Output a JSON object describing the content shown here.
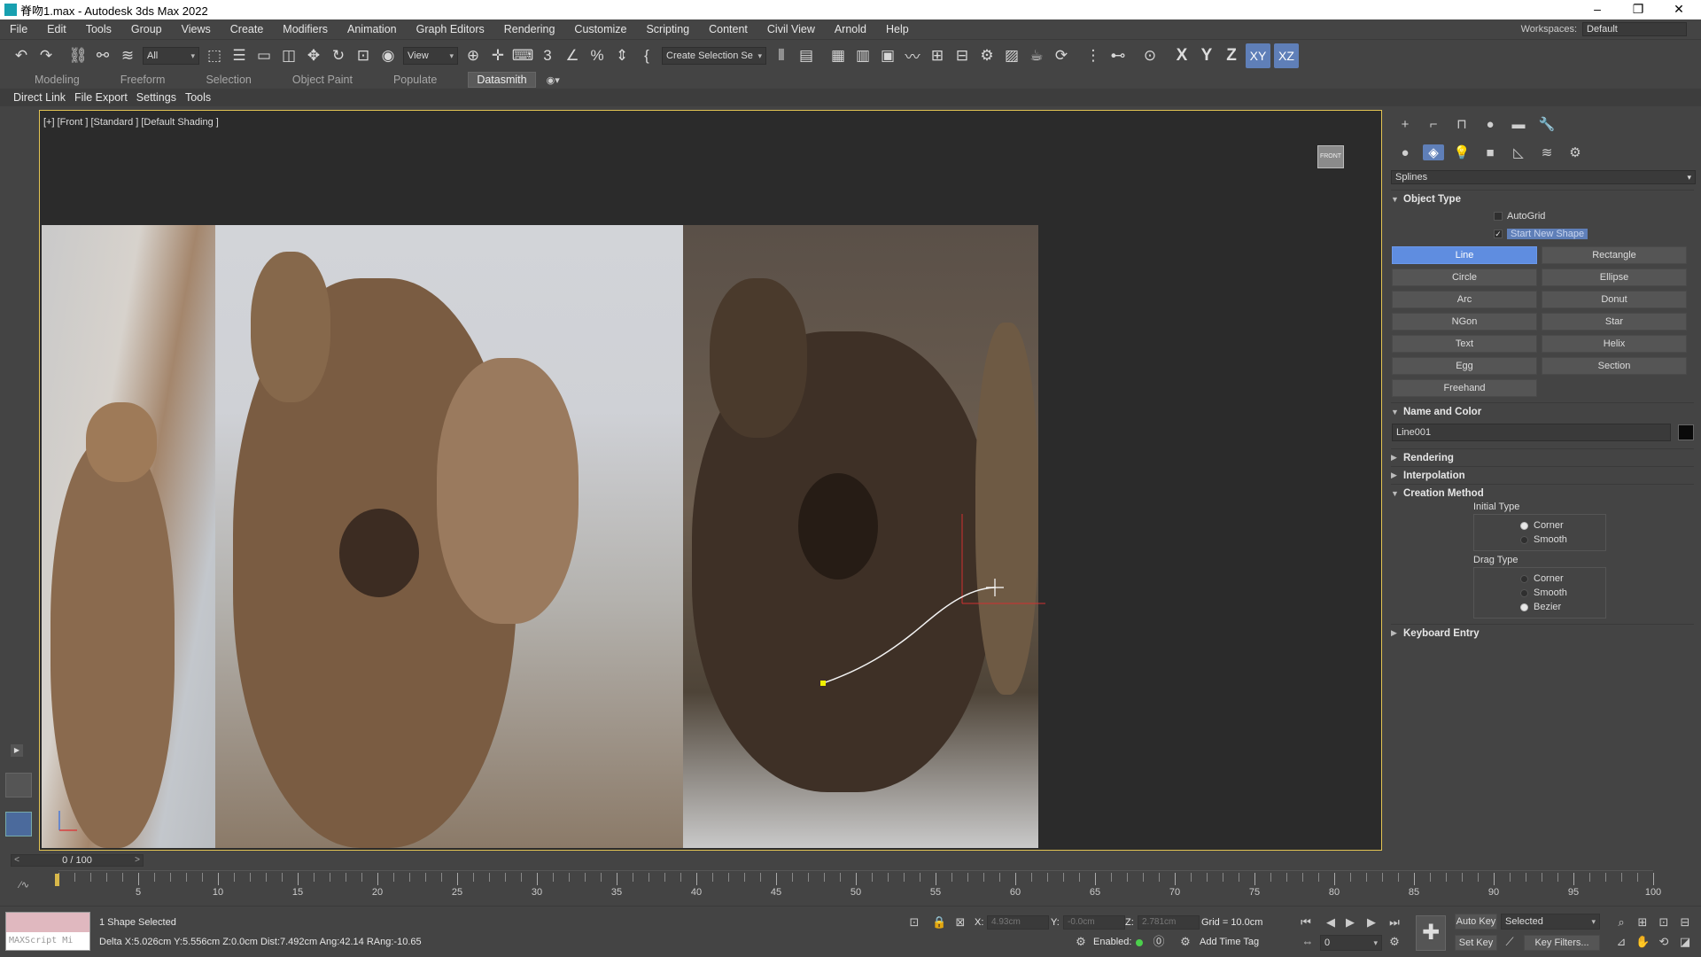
{
  "title": "脊吻1.max - Autodesk 3ds Max 2022",
  "window_controls": {
    "minimize": "–",
    "maximize": "❐",
    "close": "✕"
  },
  "menu": [
    "File",
    "Edit",
    "Tools",
    "Group",
    "Views",
    "Create",
    "Modifiers",
    "Animation",
    "Graph Editors",
    "Rendering",
    "Customize",
    "Scripting",
    "Content",
    "Civil View",
    "Arnold",
    "Help"
  ],
  "workspaces": {
    "label": "Workspaces:",
    "value": "Default"
  },
  "toolbar": {
    "filter": "All",
    "refcoord": "View",
    "selset": "Create Selection Se",
    "axes": [
      "X",
      "Y",
      "Z",
      "XY",
      "XZ"
    ]
  },
  "ribbon_tabs": [
    "Modeling",
    "Freeform",
    "Selection",
    "Object Paint",
    "Populate",
    "Datasmith"
  ],
  "ribbon_active": "Datasmith",
  "sub_ribbon": [
    "Direct Link",
    "File Export",
    "Settings",
    "Tools"
  ],
  "viewport": {
    "label": "[+] [Front ] [Standard ] [Default Shading ]",
    "viewcube": "FRONT"
  },
  "command_panel": {
    "category": "Splines",
    "object_type": {
      "title": "Object Type",
      "autogrid": "AutoGrid",
      "start_new_shape": "Start New Shape",
      "buttons": [
        "Line",
        "Rectangle",
        "Circle",
        "Ellipse",
        "Arc",
        "Donut",
        "NGon",
        "Star",
        "Text",
        "Helix",
        "Egg",
        "Section",
        "Freehand"
      ],
      "active": "Line"
    },
    "name_and_color": {
      "title": "Name and Color",
      "name": "Line001",
      "color": "#0a0a0a"
    },
    "rendering": "Rendering",
    "interpolation": "Interpolation",
    "creation_method": {
      "title": "Creation Method",
      "initial_type": {
        "label": "Initial Type",
        "options": [
          "Corner",
          "Smooth"
        ],
        "selected": "Corner"
      },
      "drag_type": {
        "label": "Drag Type",
        "options": [
          "Corner",
          "Smooth",
          "Bezier"
        ],
        "selected": "Bezier"
      }
    },
    "keyboard_entry": "Keyboard Entry"
  },
  "timeline": {
    "slider": "0 / 100",
    "ticks": [
      5,
      10,
      15,
      20,
      25,
      30,
      35,
      40,
      45,
      50,
      55,
      60,
      65,
      70,
      75,
      80,
      85,
      90,
      95,
      100
    ],
    "max": 100
  },
  "status": {
    "maxscript": "MAXScript Mi",
    "selected": "1 Shape Selected",
    "prompt": "Delta X:5.026cm  Y:5.556cm  Z:0.0cm  Dist:7.492cm Ang:42.14 RAng:-10.65",
    "x_label": "X:",
    "x_value": "4.93cm",
    "y_label": "Y:",
    "y_value": "-0.0cm",
    "z_label": "Z:",
    "z_value": "2.781cm",
    "grid": "Grid = 10.0cm",
    "enabled": "Enabled:",
    "add_time_tag": "Add Time Tag",
    "auto_key": "Auto Key",
    "set_key": "Set Key",
    "key_mode": "Selected",
    "key_filters": "Key Filters...",
    "frame": "0"
  }
}
